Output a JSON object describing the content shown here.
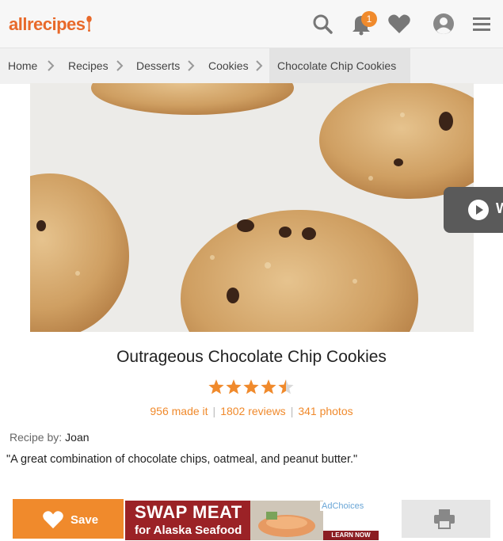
{
  "header": {
    "logo": "allrecipes",
    "notification_count": "1"
  },
  "breadcrumb": [
    "Home",
    "Recipes",
    "Desserts",
    "Cookies",
    "Chocolate Chip Cookies"
  ],
  "recipe": {
    "title": "Outrageous Chocolate Chip Cookies",
    "rating": 4.5,
    "made_it": "956 made it",
    "reviews": "1802 reviews",
    "photos": "341 photos",
    "recipe_by_label": "Recipe by:",
    "author": "Joan",
    "description": "\"A great combination of chocolate chips, oatmeal, and peanut butter.\""
  },
  "video_tab_letter": "W",
  "bottom_bar": {
    "save_label": "Save",
    "ad": {
      "headline": "SWAP MEAT",
      "subline": "for Alaska Seafood",
      "cta": "LEARN NOW",
      "adchoices": "AdChoices"
    }
  },
  "colors": {
    "accent": "#f08a2c",
    "header_bg": "#f7f7f7",
    "breadcrumb_bg": "#f1f1f1",
    "ad_bg": "#9b2226"
  }
}
